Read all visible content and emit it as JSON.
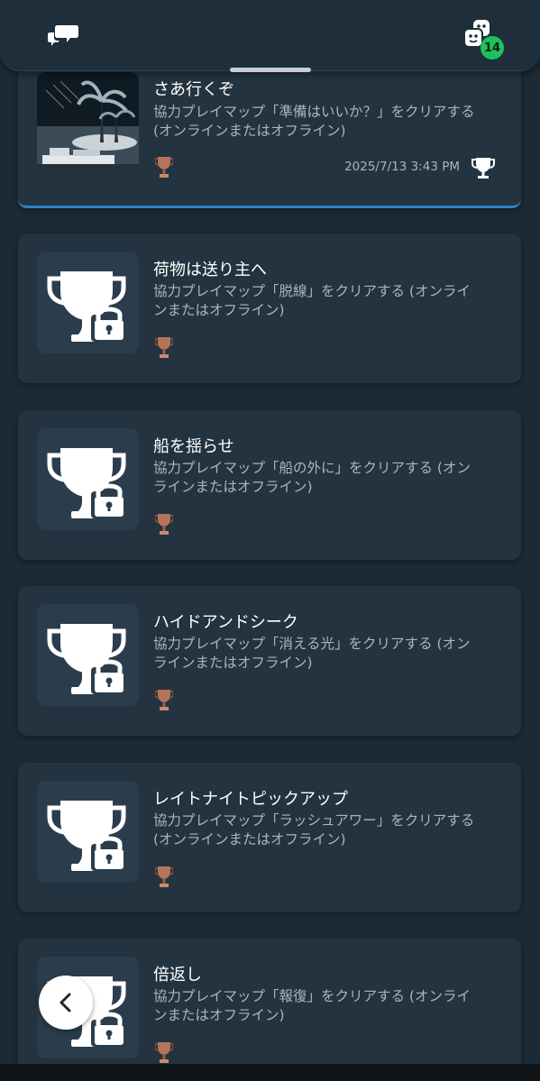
{
  "header": {
    "left_icon": "chat-bubbles-icon",
    "right_icon": "friends-icon",
    "badge_count": "14"
  },
  "trophies": [
    {
      "title": "さあ行くぞ",
      "desc_line1": "協力プレイマップ「準備はいいか？」をクリアする",
      "desc_line2": "(オンラインまたはオフライン)",
      "grade": "bronze",
      "earned": true,
      "date": "2025/7/13  3:43 PM"
    },
    {
      "title": "荷物は送り主へ",
      "desc_line1": "協力プレイマップ「脱線」をクリアする (オンライ",
      "desc_line2": "ンまたはオフライン)",
      "grade": "bronze",
      "earned": false
    },
    {
      "title": "船を揺らせ",
      "desc_line1": "協力プレイマップ「船の外に」をクリアする (オン",
      "desc_line2": "ラインまたはオフライン)",
      "grade": "bronze",
      "earned": false
    },
    {
      "title": "ハイドアンドシーク",
      "desc_line1": "協力プレイマップ「消える光」をクリアする (オン",
      "desc_line2": "ラインまたはオフライン)",
      "grade": "bronze",
      "earned": false
    },
    {
      "title": "レイトナイトピックアップ",
      "desc_line1": "協力プレイマップ「ラッシュアワー」をクリアする",
      "desc_line2": "(オンラインまたはオフライン)",
      "grade": "bronze",
      "earned": false
    },
    {
      "title": "倍返し",
      "desc_line1": "協力プレイマップ「報復」をクリアする (オンライ",
      "desc_line2": "ンまたはオフライン)",
      "grade": "bronze",
      "earned": false
    }
  ],
  "colors": {
    "background": "#1b2a35",
    "card": "#23333f",
    "accent": "#2f7fc0",
    "badge": "#1fc15a",
    "bronze": "#b4745a"
  }
}
